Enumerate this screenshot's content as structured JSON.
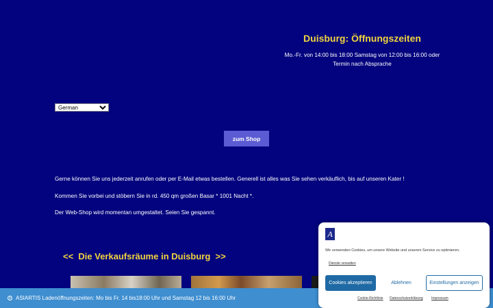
{
  "hours": {
    "title": "Duisburg: Öffnungszeiten",
    "text": "Mo.-Fr. von 14:00 bis 18:00 Samstag von 12:00 bis 16:00 oder Termin nach Absprache"
  },
  "language_select": {
    "value": "German"
  },
  "shop_button": {
    "label": "zum Shop"
  },
  "intro": {
    "p1": "Gerne können Sie uns jederzeit anrufen oder per E-Mail etwas bestellen. Generell ist alles was Sie sehen verkäuflich, bis auf unseren Kater !",
    "p2": "Kommen Sie vorbei und stöbern Sie in rd. 450 qm großen Basar  * 1001 Nacht *.",
    "p3": "Der Web-Shop wird momentan umgestaltet. Seien Sie gespannt."
  },
  "section": {
    "title": "<<  Die Verkaufsräume in Duisburg  >>"
  },
  "banner": {
    "icon": "info-icon",
    "text": "ASIARTIS Ladenöffnungszeiten: Mo bis Fr. 14 bis18:00 Uhr und Samstag 12 bis 16:00 Uhr"
  },
  "cookie": {
    "logo": "A",
    "text": "Wir verwenden Cookies, um unsere Website und unseren Service zu optimieren.",
    "services_link": "Dienste verwalten",
    "accept": "Cookies akzeptieren",
    "deny": "Ablehnen",
    "preferences": "Einstellungen anzeigen",
    "footer": [
      "Cookie-Richtlinie",
      "Datenschutzerklärung",
      "Impressum"
    ]
  },
  "colors": {
    "background": "#03037f",
    "heading": "#f2d43d",
    "button": "#5b5bd3",
    "banner": "#3e8ed0",
    "cookie_primary": "#1f6aa5"
  }
}
